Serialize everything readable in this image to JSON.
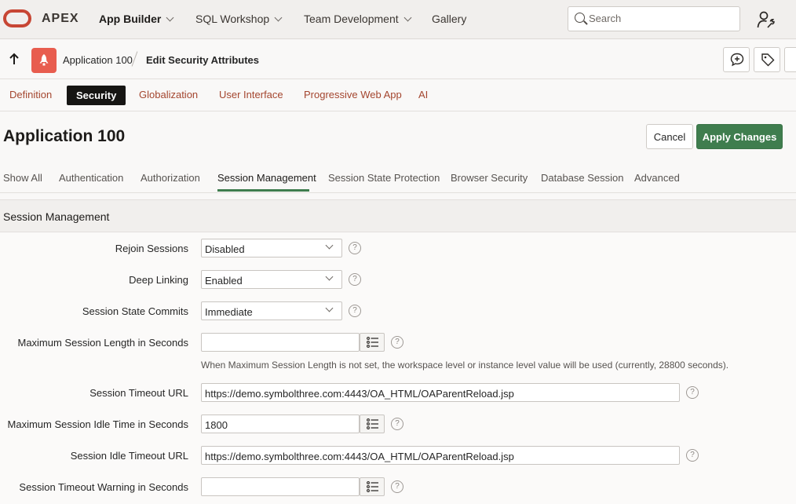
{
  "topnav": {
    "brand": "APEX",
    "items": [
      {
        "label": "App Builder"
      },
      {
        "label": "SQL Workshop"
      },
      {
        "label": "Team Development"
      },
      {
        "label": "Gallery"
      }
    ],
    "search_placeholder": "Search"
  },
  "breadcrumb": {
    "app": "Application 100",
    "page": "Edit Security Attributes"
  },
  "def_tabs": [
    "Definition",
    "Security",
    "Globalization",
    "User Interface",
    "Progressive Web App",
    "AI"
  ],
  "page": {
    "title": "Application 100",
    "cancel": "Cancel",
    "apply": "Apply Changes"
  },
  "sub_tabs": [
    "Show All",
    "Authentication",
    "Authorization",
    "Session Management",
    "Session State Protection",
    "Browser Security",
    "Database Session",
    "Advanced"
  ],
  "region": {
    "title": "Session Management",
    "fields": {
      "rejoin": {
        "label": "Rejoin Sessions",
        "value": "Disabled"
      },
      "deep_linking": {
        "label": "Deep Linking",
        "value": "Enabled"
      },
      "state_commits": {
        "label": "Session State Commits",
        "value": "Immediate"
      },
      "max_length": {
        "label": "Maximum Session Length in Seconds",
        "value": ""
      },
      "hint": "When Maximum Session Length is not set, the workspace level or instance level value will be used (currently, 28800 seconds).",
      "timeout_url": {
        "label": "Session Timeout URL",
        "value": "https://demo.symbolthree.com:4443/OA_HTML/OAParentReload.jsp"
      },
      "idle_time": {
        "label": "Maximum Session Idle Time in Seconds",
        "value": "1800"
      },
      "idle_url": {
        "label": "Session Idle Timeout URL",
        "value": "https://demo.symbolthree.com:4443/OA_HTML/OAParentReload.jsp"
      },
      "warning": {
        "label": "Session Timeout Warning in Seconds",
        "value": ""
      }
    },
    "help_glyph": "?"
  },
  "colors": {
    "accent_green": "#3f7d4e",
    "link": "#a4462f",
    "oracle_red": "#c74634"
  }
}
